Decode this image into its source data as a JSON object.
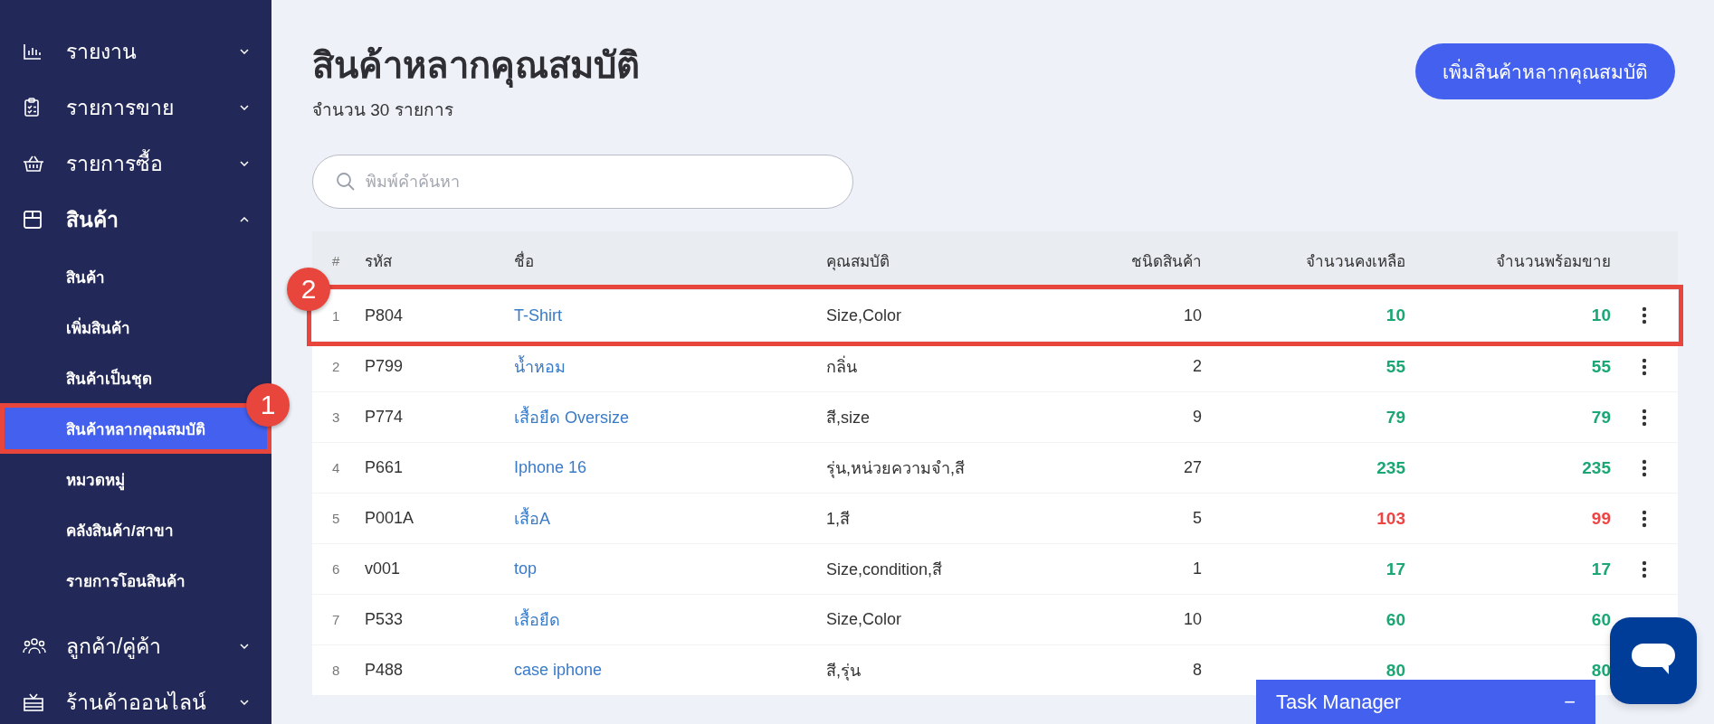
{
  "sidebar": {
    "items": [
      {
        "label": "รายงาน",
        "expanded": false
      },
      {
        "label": "รายการขาย",
        "expanded": false
      },
      {
        "label": "รายการซื้อ",
        "expanded": false
      },
      {
        "label": "สินค้า",
        "expanded": true,
        "children": [
          {
            "label": "สินค้า",
            "selected": false
          },
          {
            "label": "เพิ่มสินค้า",
            "selected": false
          },
          {
            "label": "สินค้าเป็นชุด",
            "selected": false
          },
          {
            "label": "สินค้าหลากคุณสมบัติ",
            "selected": true,
            "callout": "1"
          },
          {
            "label": "หมวดหมู่",
            "selected": false
          },
          {
            "label": "คลังสินค้า/สาขา",
            "selected": false
          },
          {
            "label": "รายการโอนสินค้า",
            "selected": false
          }
        ]
      },
      {
        "label": "ลูกค้า/คู่ค้า",
        "expanded": false
      },
      {
        "label": "ร้านค้าออนไลน์",
        "expanded": false
      }
    ]
  },
  "header": {
    "title": "สินค้าหลากคุณสมบัติ",
    "count": "จำนวน 30 รายการ",
    "add_button": "เพิ่มสินค้าหลากคุณสมบัติ"
  },
  "search": {
    "placeholder": "พิมพ์คำค้นหา"
  },
  "table": {
    "columns": [
      "#",
      "รหัส",
      "ชื่อ",
      "คุณสมบัติ",
      "ชนิดสินค้า",
      "จำนวนคงเหลือ",
      "จำนวนพร้อมขาย"
    ],
    "rows": [
      {
        "index": "1",
        "code": "P804",
        "name": "T-Shirt",
        "attributes": "Size,Color",
        "types": "10",
        "remaining": "10",
        "available": "10",
        "color": "#1aa774",
        "callout": "2"
      },
      {
        "index": "2",
        "code": "P799",
        "name": "น้ำหอม",
        "attributes": "กลิ่น",
        "types": "2",
        "remaining": "55",
        "available": "55",
        "color": "#1aa774"
      },
      {
        "index": "3",
        "code": "P774",
        "name": "เสื้อยืด Oversize",
        "attributes": "สี,size",
        "types": "9",
        "remaining": "79",
        "available": "79",
        "color": "#1aa774"
      },
      {
        "index": "4",
        "code": "P661",
        "name": "Iphone 16",
        "attributes": "รุ่น,หน่วยความจำ,สี",
        "types": "27",
        "remaining": "235",
        "available": "235",
        "color": "#1aa774"
      },
      {
        "index": "5",
        "code": "P001A",
        "name": "เสื้อA",
        "attributes": "1,สี",
        "types": "5",
        "remaining": "103",
        "available": "99",
        "color": "#ef4444"
      },
      {
        "index": "6",
        "code": "v001",
        "name": "top",
        "attributes": "Size,condition,สี",
        "types": "1",
        "remaining": "17",
        "available": "17",
        "color": "#1aa774"
      },
      {
        "index": "7",
        "code": "P533",
        "name": "เสื้อยืด",
        "attributes": "Size,Color",
        "types": "10",
        "remaining": "60",
        "available": "60",
        "color": "#1aa774"
      },
      {
        "index": "8",
        "code": "P488",
        "name": "case iphone",
        "attributes": "สี,รุ่น",
        "types": "8",
        "remaining": "80",
        "available": "80",
        "color": "#1aa774"
      }
    ]
  },
  "task_manager": {
    "title": "Task Manager",
    "toggle": "−"
  }
}
